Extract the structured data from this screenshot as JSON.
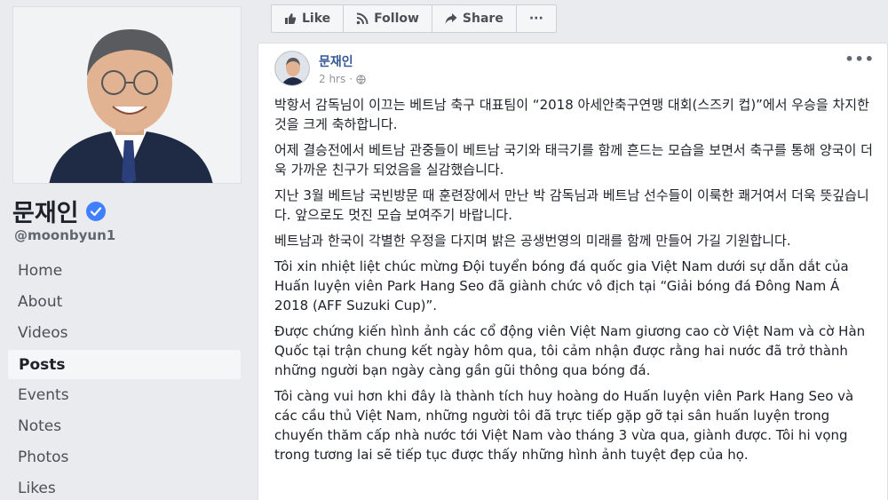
{
  "profile": {
    "name": "문재인",
    "handle": "@moonbyun1",
    "verified": true
  },
  "nav": {
    "items": [
      {
        "label": "Home"
      },
      {
        "label": "About"
      },
      {
        "label": "Videos"
      },
      {
        "label": "Posts",
        "active": true
      },
      {
        "label": "Events"
      },
      {
        "label": "Notes"
      },
      {
        "label": "Photos"
      },
      {
        "label": "Likes"
      }
    ]
  },
  "actions": {
    "like": "Like",
    "follow": "Follow",
    "share": "Share",
    "more": "···"
  },
  "post": {
    "author": "문재인",
    "time": "2 hrs",
    "privacy_icon": "globe-icon",
    "more": "•••",
    "paragraphs": [
      "박항서 감독님이 이끄는 베트남 축구 대표팀이 “2018 아세안축구연맹 대회(스즈키 컵)”에서 우승을 차지한 것을 크게 축하합니다.",
      "어제 결승전에서 베트남 관중들이 베트남 국기와 태극기를 함께 흔드는 모습을 보면서 축구를 통해 양국이 더욱 가까운 친구가 되었음을 실감했습니다.",
      "지난 3월 베트남 국빈방문 때 훈련장에서 만난 박 감독님과 베트남 선수들이 이룩한 쾌거여서 더욱 뜻깊습니다. 앞으로도 멋진 모습 보여주기 바랍니다.",
      "베트남과 한국이 각별한 우정을 다지며 밝은 공생번영의 미래를 함께 만들어 가길 기원합니다.",
      "Tôi xin nhiệt liệt chúc mừng Đội tuyển bóng đá quốc gia Việt Nam dưới sự dẫn dắt của Huấn luyện viên Park Hang Seo đã giành chức vô địch tại “Giải bóng đá Đông Nam Á 2018 (AFF Suzuki Cup)”.",
      "Được chứng kiến hình ảnh các cổ động viên Việt Nam giương cao cờ Việt Nam và cờ Hàn Quốc tại trận chung kết ngày hôm qua, tôi cảm nhận được rằng hai nước đã trở thành những người bạn ngày càng gần gũi thông qua bóng đá.",
      "Tôi càng vui hơn khi đây là thành tích huy hoàng do Huấn luyện viên Park Hang Seo và các cầu thủ Việt Nam, những người tôi đã trực tiếp gặp gỡ tại sân huấn luyện trong chuyến thăm cấp nhà nước tới Việt Nam vào tháng 3 vừa qua, giành được. Tôi hi vọng trong tương lai sẽ tiếp tục được thấy những hình ảnh tuyệt đẹp của họ."
    ]
  },
  "colors": {
    "background": "#e9ebee",
    "link": "#365899",
    "verified": "#4080ff"
  }
}
